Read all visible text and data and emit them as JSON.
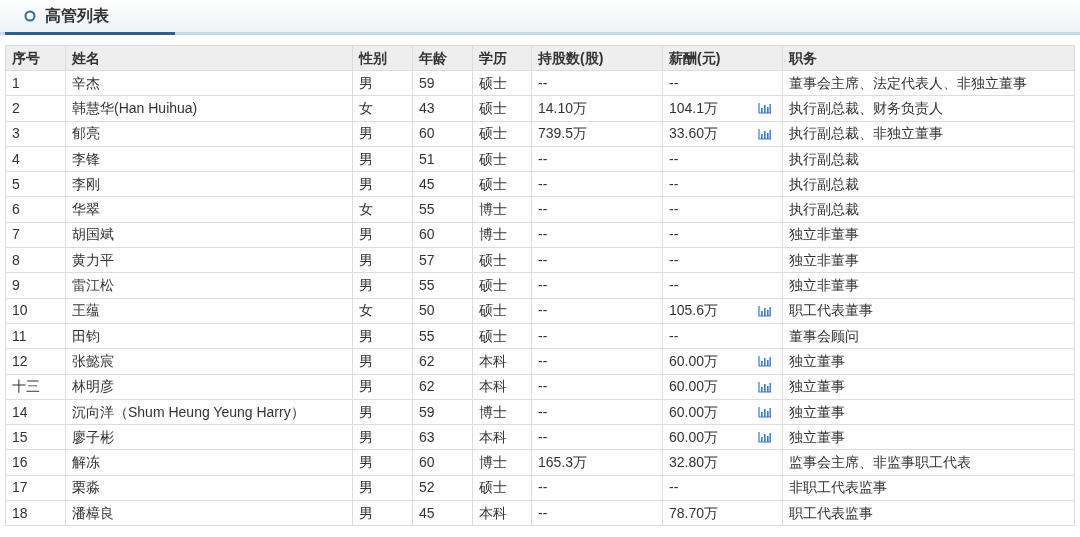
{
  "section": {
    "title": "高管列表"
  },
  "table": {
    "columns": [
      "序号",
      "姓名",
      "性别",
      "年龄",
      "学历",
      "持股数(股)",
      "薪酬(元)",
      "职务"
    ],
    "rows": [
      {
        "no": "1",
        "name": "辛杰",
        "gender": "男",
        "age": "59",
        "education": "硕士",
        "shares": "--",
        "salary": "--",
        "salary_chart": false,
        "position": "董事会主席、法定代表人、非独立董事"
      },
      {
        "no": "2",
        "name": "韩慧华(Han Huihua)",
        "gender": "女",
        "age": "43",
        "education": "硕士",
        "shares": "14.10万",
        "salary": "104.1万",
        "salary_chart": true,
        "position": "执行副总裁、财务负责人"
      },
      {
        "no": "3",
        "name": "郁亮",
        "gender": "男",
        "age": "60",
        "education": "硕士",
        "shares": "739.5万",
        "salary": "33.60万",
        "salary_chart": true,
        "position": "执行副总裁、非独立董事"
      },
      {
        "no": "4",
        "name": "李锋",
        "gender": "男",
        "age": "51",
        "education": "硕士",
        "shares": "--",
        "salary": "--",
        "salary_chart": false,
        "position": "执行副总裁"
      },
      {
        "no": "5",
        "name": "李刚",
        "gender": "男",
        "age": "45",
        "education": "硕士",
        "shares": "--",
        "salary": "--",
        "salary_chart": false,
        "position": "执行副总裁"
      },
      {
        "no": "6",
        "name": "华翠",
        "gender": "女",
        "age": "55",
        "education": "博士",
        "shares": "--",
        "salary": "--",
        "salary_chart": false,
        "position": "执行副总裁"
      },
      {
        "no": "7",
        "name": "胡国斌",
        "gender": "男",
        "age": "60",
        "education": "博士",
        "shares": "--",
        "salary": "--",
        "salary_chart": false,
        "position": "独立非董事"
      },
      {
        "no": "8",
        "name": "黄力平",
        "gender": "男",
        "age": "57",
        "education": "硕士",
        "shares": "--",
        "salary": "--",
        "salary_chart": false,
        "position": "独立非董事"
      },
      {
        "no": "9",
        "name": "雷江松",
        "gender": "男",
        "age": "55",
        "education": "硕士",
        "shares": "--",
        "salary": "--",
        "salary_chart": false,
        "position": "独立非董事"
      },
      {
        "no": "10",
        "name": "王蕴",
        "gender": "女",
        "age": "50",
        "education": "硕士",
        "shares": "--",
        "salary": "105.6万",
        "salary_chart": true,
        "position": "职工代表董事"
      },
      {
        "no": "11",
        "name": "田钧",
        "gender": "男",
        "age": "55",
        "education": "硕士",
        "shares": "--",
        "salary": "--",
        "salary_chart": false,
        "position": "董事会顾问"
      },
      {
        "no": "12",
        "name": "张懿宸",
        "gender": "男",
        "age": "62",
        "education": "本科",
        "shares": "--",
        "salary": "60.00万",
        "salary_chart": true,
        "position": "独立董事"
      },
      {
        "no": "十三",
        "name": "林明彦",
        "gender": "男",
        "age": "62",
        "education": "本科",
        "shares": "--",
        "salary": "60.00万",
        "salary_chart": true,
        "position": "独立董事"
      },
      {
        "no": "14",
        "name": "沉向洋（Shum Heung Yeung Harry）",
        "gender": "男",
        "age": "59",
        "education": "博士",
        "shares": "--",
        "salary": "60.00万",
        "salary_chart": true,
        "position": "独立董事"
      },
      {
        "no": "15",
        "name": "廖子彬",
        "gender": "男",
        "age": "63",
        "education": "本科",
        "shares": "--",
        "salary": "60.00万",
        "salary_chart": true,
        "position": "独立董事"
      },
      {
        "no": "16",
        "name": "解冻",
        "gender": "男",
        "age": "60",
        "education": "博士",
        "shares": "165.3万",
        "salary": "32.80万",
        "salary_chart": false,
        "position": "监事会主席、非监事职工代表"
      },
      {
        "no": "17",
        "name": "栗淼",
        "gender": "男",
        "age": "52",
        "education": "硕士",
        "shares": "--",
        "salary": "--",
        "salary_chart": false,
        "position": "非职工代表监事"
      },
      {
        "no": "18",
        "name": "潘樟良",
        "gender": "男",
        "age": "45",
        "education": "本科",
        "shares": "--",
        "salary": "78.70万",
        "salary_chart": false,
        "position": "职工代表监事"
      }
    ]
  }
}
